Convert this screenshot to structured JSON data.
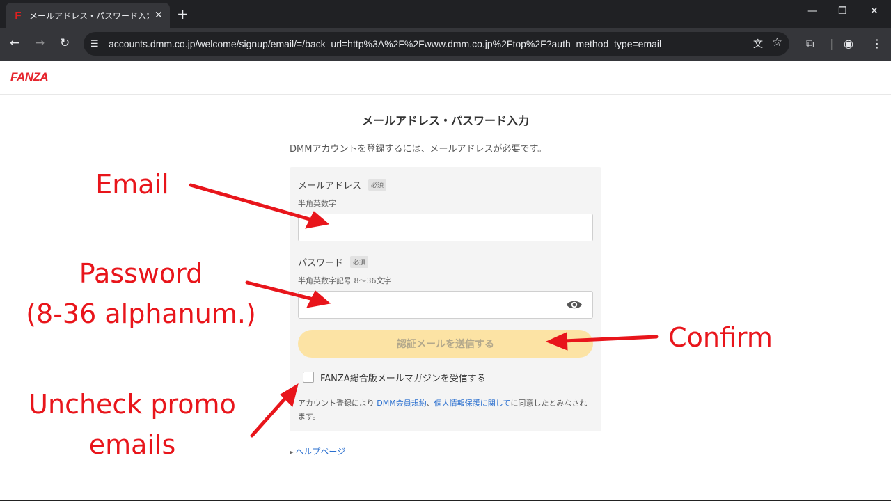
{
  "browser": {
    "tab_favicon": "F",
    "tab_title": "メールアドレス・パスワード入力 - FANZA",
    "tab_close": "✕",
    "new_tab": "+",
    "window_controls": {
      "minimize": "—",
      "restore": "❐",
      "close": "✕"
    },
    "nav": {
      "back": "←",
      "forward": "→",
      "reload": "↻"
    },
    "url": "accounts.dmm.co.jp/welcome/signup/email/=/back_url=http%3A%2F%2Fwww.dmm.co.jp%2Ftop%2F?auth_method_type=email",
    "icons": [
      "tune-icon",
      "translate-icon",
      "bookmark-star-icon",
      "tab-search-icon",
      "profile-icon",
      "menu-icon"
    ]
  },
  "site": {
    "logo": "FANZA"
  },
  "form": {
    "title": "メールアドレス・パスワード入力",
    "subtitle": "DMMアカウントを登録するには、メールアドレスが必要です。",
    "email": {
      "label": "メールアドレス",
      "required": "必須",
      "hint": "半角英数字",
      "value": ""
    },
    "password": {
      "label": "パスワード",
      "required": "必須",
      "hint": "半角英数字記号 8〜36文字",
      "value": ""
    },
    "submit": "認証メールを送信する",
    "newsletter": "FANZA総合版メールマガジンを受信する",
    "terms_before": "アカウント登録により ",
    "terms_link1": "DMM会員規約",
    "terms_sep": "、",
    "terms_link2": "個人情報保護に関して",
    "terms_after": "に同意したとみなされます。",
    "help": "ヘルプページ"
  },
  "annotations": {
    "email": "Email",
    "password_line1": "Password",
    "password_line2": "(8-36 alphanum.)",
    "confirm": "Confirm",
    "promo_line1": "Uncheck promo",
    "promo_line2": "emails"
  },
  "colors": {
    "annotation": "#e8151b",
    "brand": "#e5242c",
    "button": "#fce3a4",
    "link": "#2a6fcf"
  }
}
